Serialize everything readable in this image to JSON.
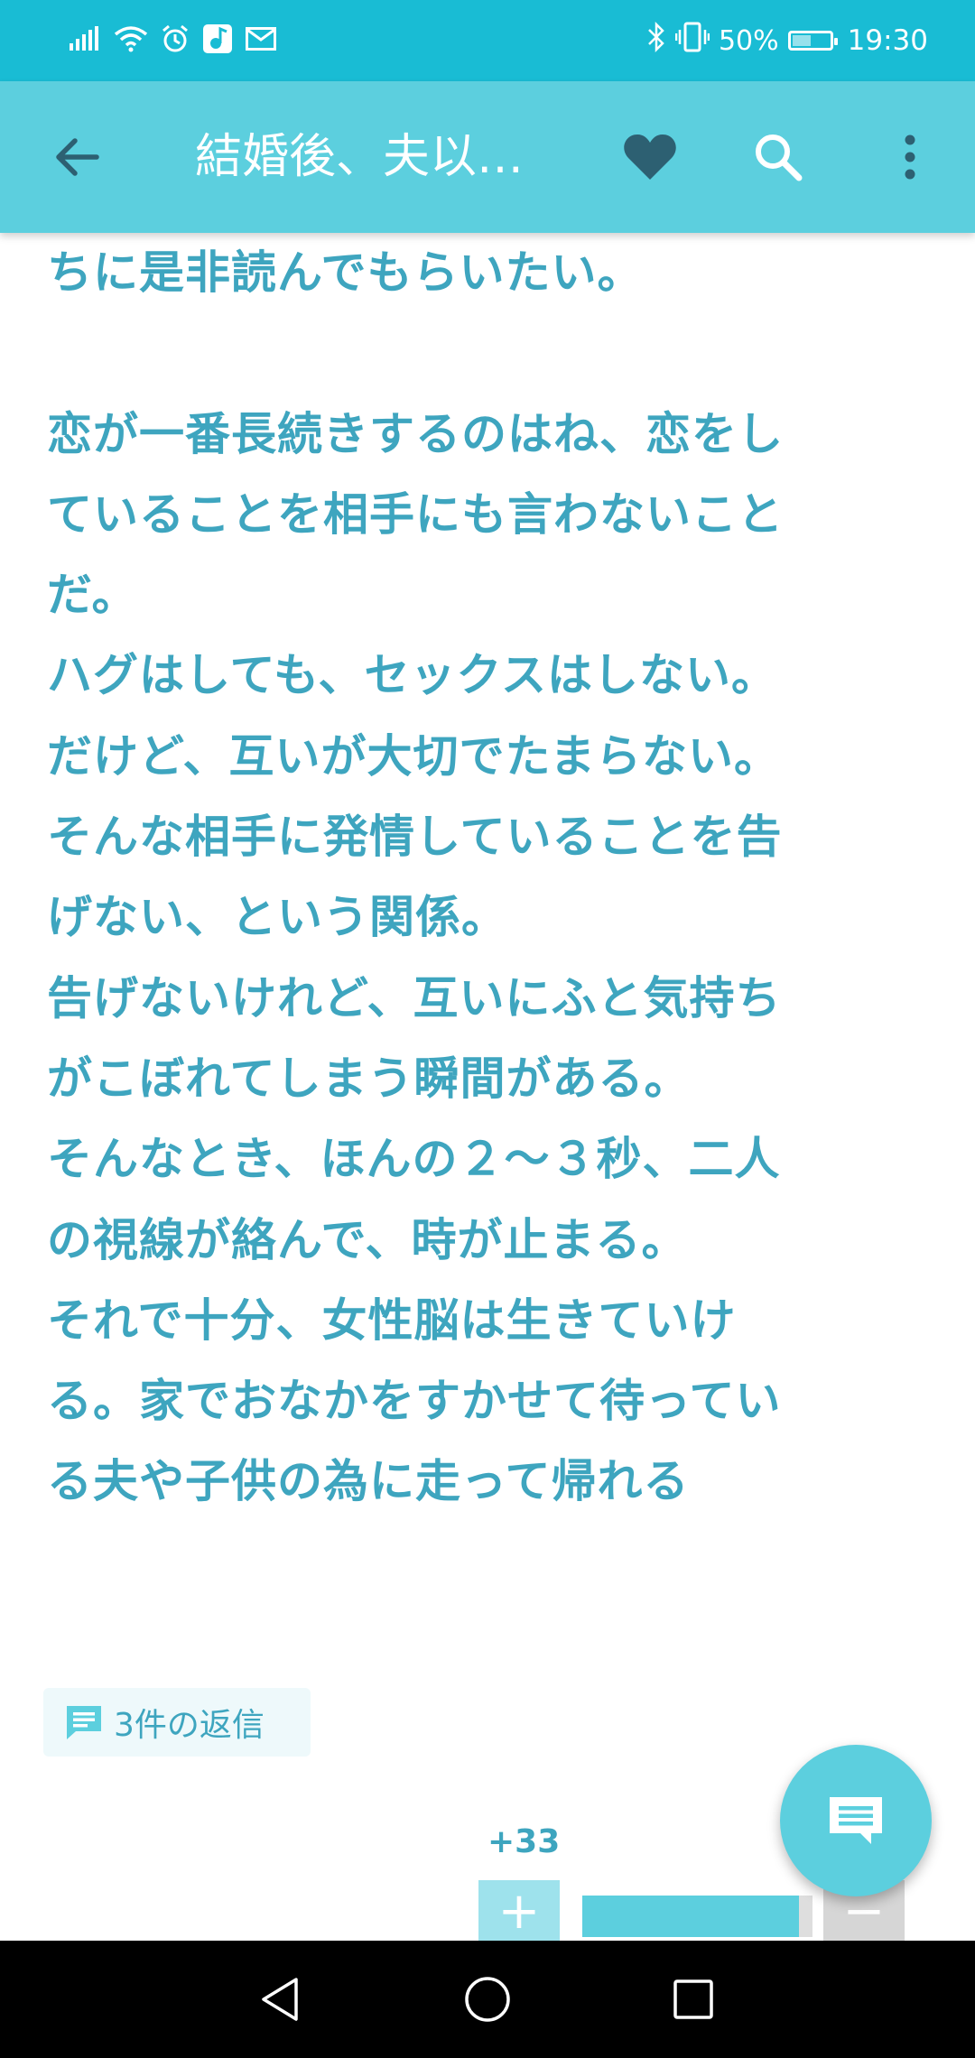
{
  "status_bar": {
    "time": "19:30",
    "battery_percent": "50%",
    "battery_level": 0.5,
    "left_icons": [
      "signal-icon",
      "wifi-icon",
      "alarm-icon",
      "music-app-icon",
      "mail-icon"
    ],
    "right_icons": [
      "bluetooth-icon",
      "vibrate-icon",
      "battery-icon"
    ]
  },
  "app_bar": {
    "title": "結婚後、夫以…",
    "back_icon": "back-arrow-icon",
    "favorite_icon": "heart-icon",
    "search_icon": "search-icon",
    "menu_icon": "more-vert-icon"
  },
  "post": {
    "lines": [
      "ちに是非読んでもらいたい。",
      "",
      "恋が一番長続きするのはね、恋をし",
      "ていることを相手にも言わないこと",
      "だ。",
      "ハグはしても、セックスはしない。",
      "だけど、互いが大切でたまらない。",
      "そんな相手に発情していることを告",
      "げない、という関係。",
      "告げないけれど、互いにふと気持ち",
      "がこぼれてしまう瞬間がある。",
      "そんなとき、ほんの２〜３秒、二人",
      "の視線が絡んで、時が止まる。",
      "それで十分、女性脳は生きていけ",
      "る。家でおなかをすかせて待ってい",
      "る夫や子供の為に走って帰れる"
    ],
    "replies_label": "3件の返信"
  },
  "voting": {
    "count": "+33",
    "plus_label": "+",
    "minus_label": "−",
    "positive_ratio": 0.94
  },
  "colors": {
    "status_bar": "#19bcd4",
    "app_bar": "#5ccfde",
    "text": "#3ea5bf",
    "nav_bar": "#000000"
  }
}
